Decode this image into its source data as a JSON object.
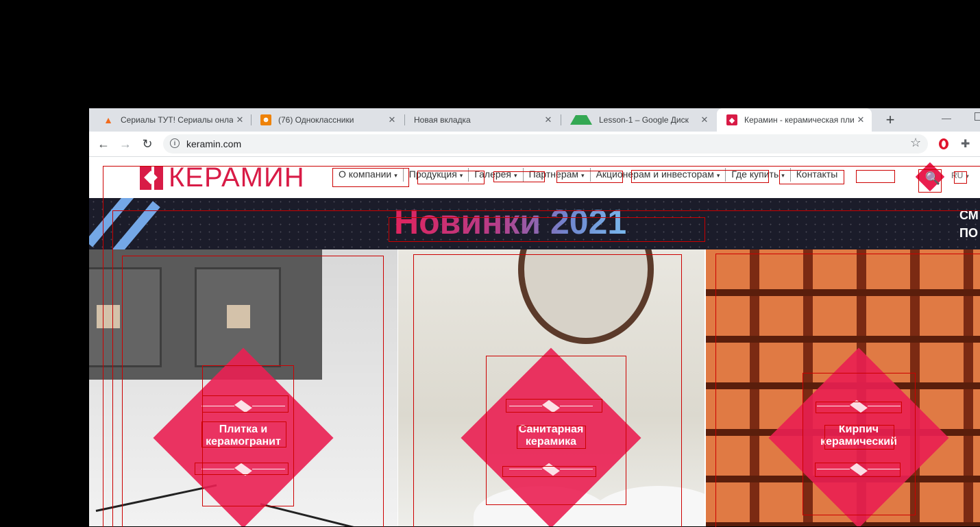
{
  "browser": {
    "tabs": [
      {
        "title": "Сериалы ТУТ! Сериалы онлайн",
        "favicon": "fire-icon",
        "active": false
      },
      {
        "title": "(76) Одноклассники",
        "favicon": "ok-icon",
        "active": false
      },
      {
        "title": "Новая вкладка",
        "favicon": "",
        "active": false
      },
      {
        "title": "Lesson-1 – Google Диск",
        "favicon": "drive-icon",
        "active": false
      },
      {
        "title": "Керамин - керамическая плитка",
        "favicon": "keramin-icon",
        "active": true
      }
    ],
    "new_tab_label": "+",
    "minimize_label": "—",
    "url": "keramin.com"
  },
  "site": {
    "logo_text": "КЕРАМИН",
    "nav": [
      {
        "label": "О компании",
        "dropdown": true
      },
      {
        "label": "Продукция",
        "dropdown": true
      },
      {
        "label": "Галерея",
        "dropdown": true
      },
      {
        "label": "Партнерам",
        "dropdown": true
      },
      {
        "label": "Акционерам и инвесторам",
        "dropdown": true
      },
      {
        "label": "Где купить",
        "dropdown": true
      },
      {
        "label": "Контакты",
        "dropdown": false
      }
    ],
    "caret": "▾",
    "search_icon": "🔍",
    "language": "RU",
    "banner": {
      "title": "Новинки 2021",
      "side_line1": "СМ",
      "side_line2": "ПО"
    },
    "categories": [
      {
        "line1": "Плитка и",
        "line2": "керамогранит"
      },
      {
        "line1": "Санитарная",
        "line2": "керамика"
      },
      {
        "line1": "Кирпич",
        "line2": "керамический"
      }
    ]
  },
  "colors": {
    "brand": "#d81b46",
    "diamond": "#ea1f52",
    "overlay_box": "#cc0000"
  }
}
